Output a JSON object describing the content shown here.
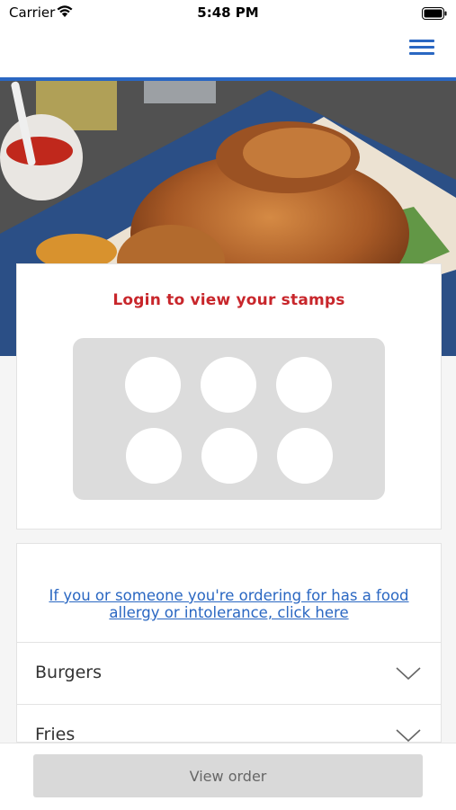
{
  "status_bar": {
    "carrier": "Carrier",
    "time": "5:48 PM"
  },
  "nav": {
    "menu_icon": "hamburger-menu-icon"
  },
  "hero": {
    "image": "roast-chicken-photo"
  },
  "stamps": {
    "title": "Login to view your stamps",
    "count": 6,
    "collected": 0
  },
  "allergy": {
    "link_text": "If you or someone you're ordering for has a food allergy or intolerance, click here"
  },
  "menu": {
    "categories": [
      {
        "label": "Burgers",
        "icon": "chevron-down-icon"
      },
      {
        "label": "Fries",
        "icon": "chevron-down-icon"
      }
    ]
  },
  "bottom": {
    "view_order_label": "View order"
  },
  "colors": {
    "accent": "#2a67c2",
    "stamp_title": "#c8262b",
    "button_bg": "#d9d9d9"
  }
}
